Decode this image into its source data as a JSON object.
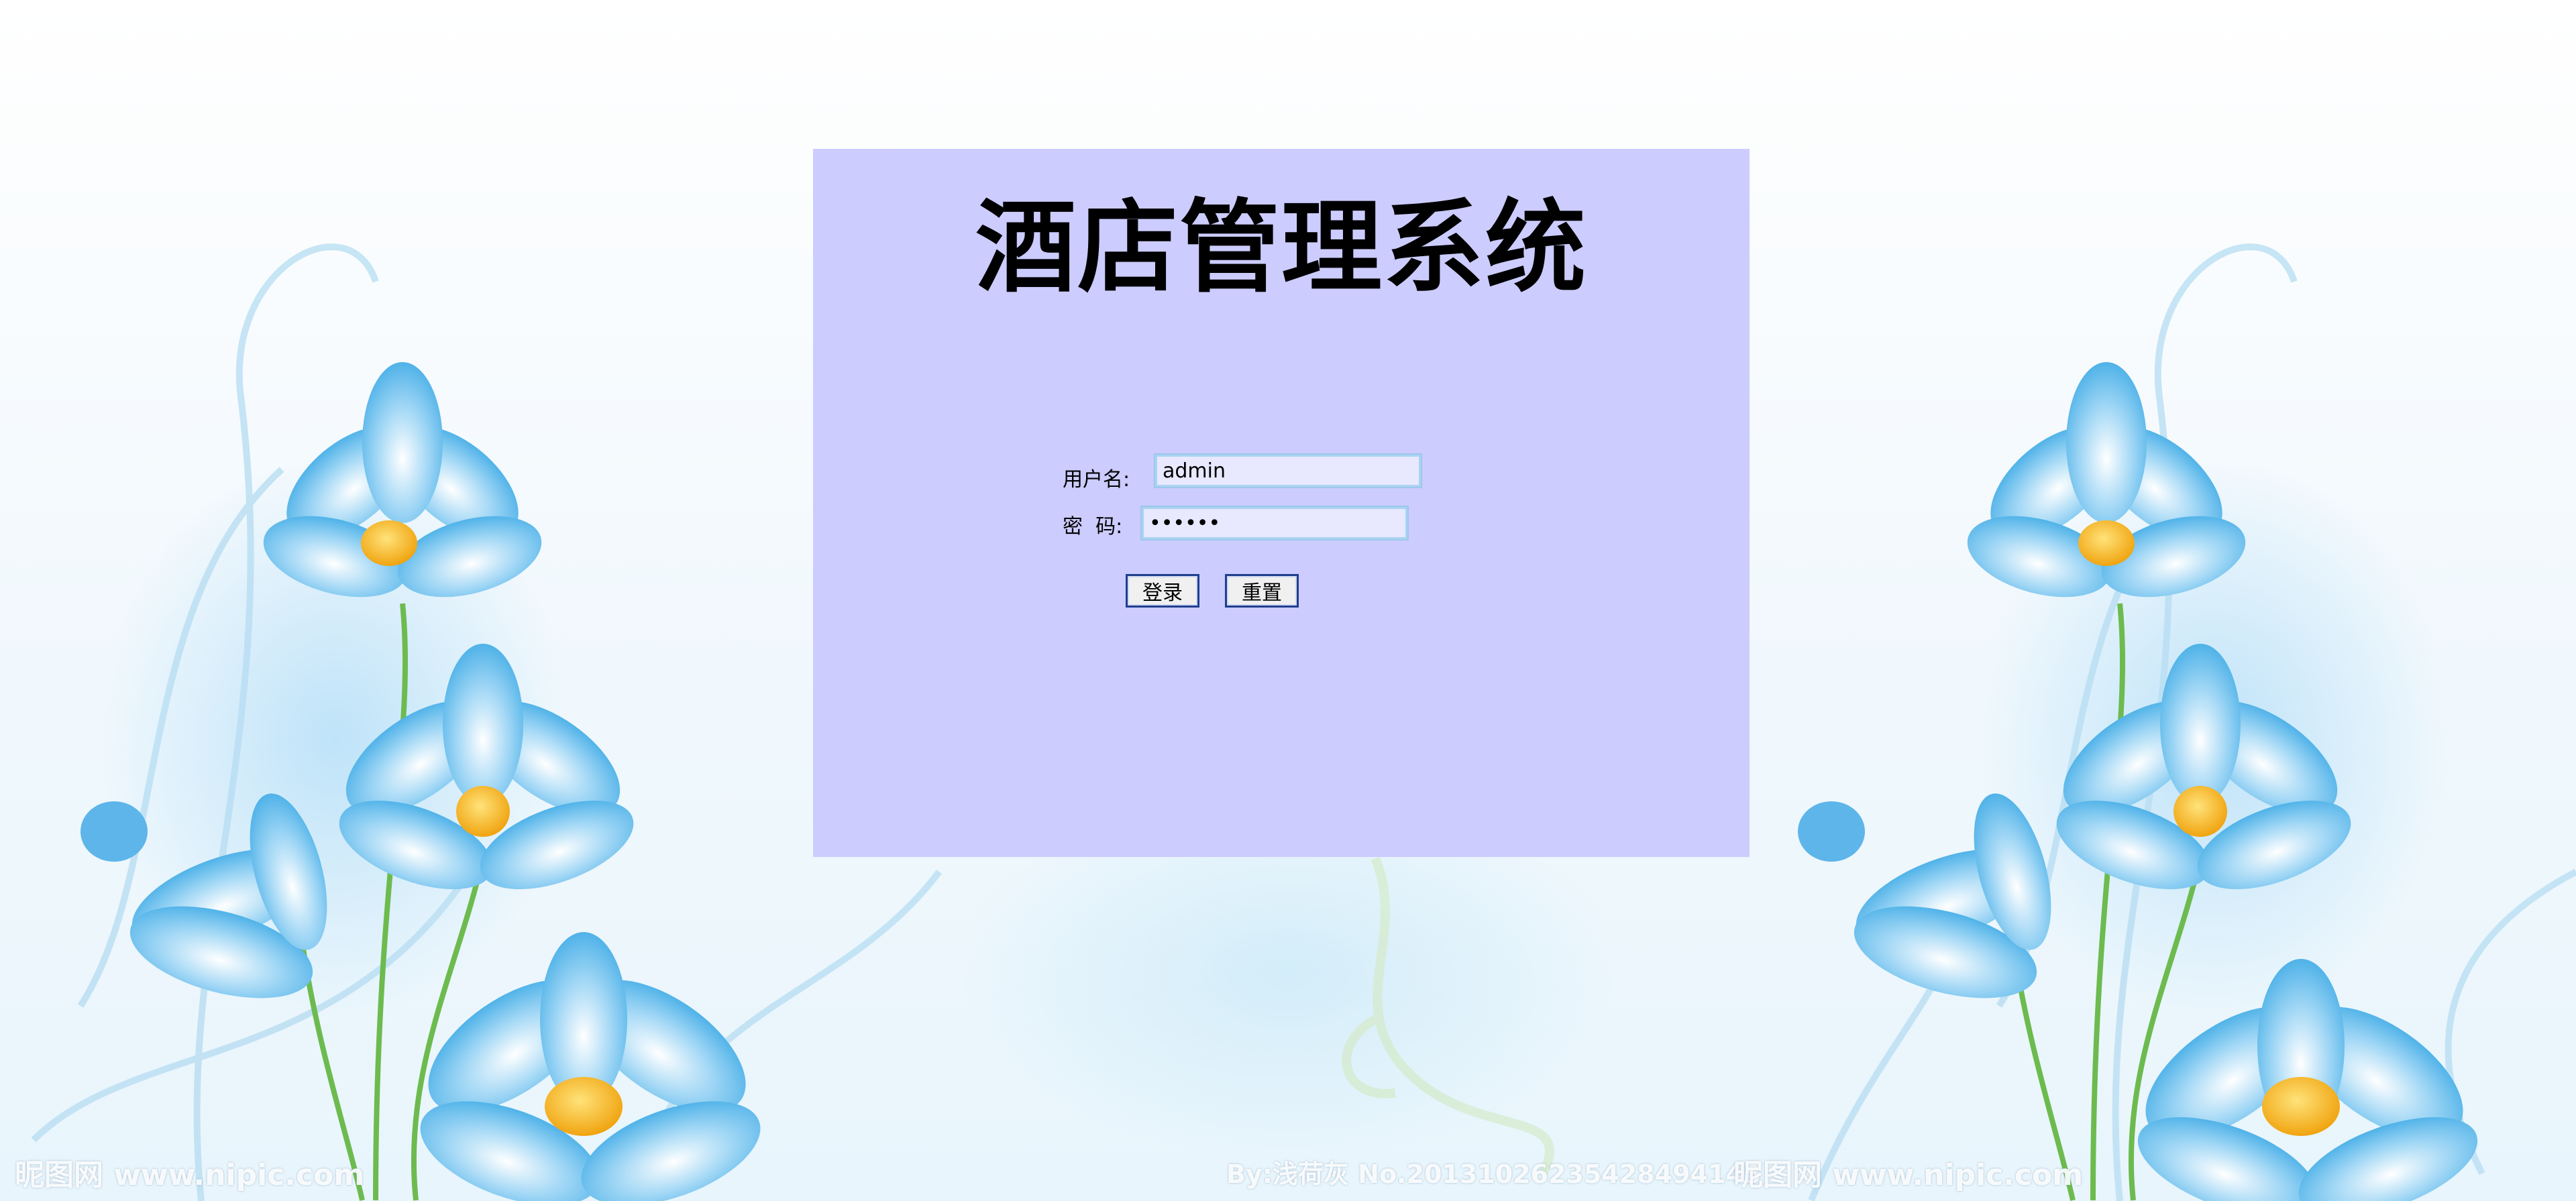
{
  "app": {
    "title": "酒店管理系统"
  },
  "login_form": {
    "username_label": "用户名:",
    "username_value": "admin",
    "password_label": "密  码:",
    "password_value": "••••••",
    "login_button": "登录",
    "reset_button": "重置"
  },
  "watermarks": {
    "left": "昵图网 www.nipic.com",
    "center": "By:浅荷灰 No.20131026235428494145",
    "right": "昵图网 www.nipic.com"
  },
  "colors": {
    "panel": "#ccccff",
    "input_bg": "#e8e8ff",
    "button_border": "#1f3f8f"
  }
}
